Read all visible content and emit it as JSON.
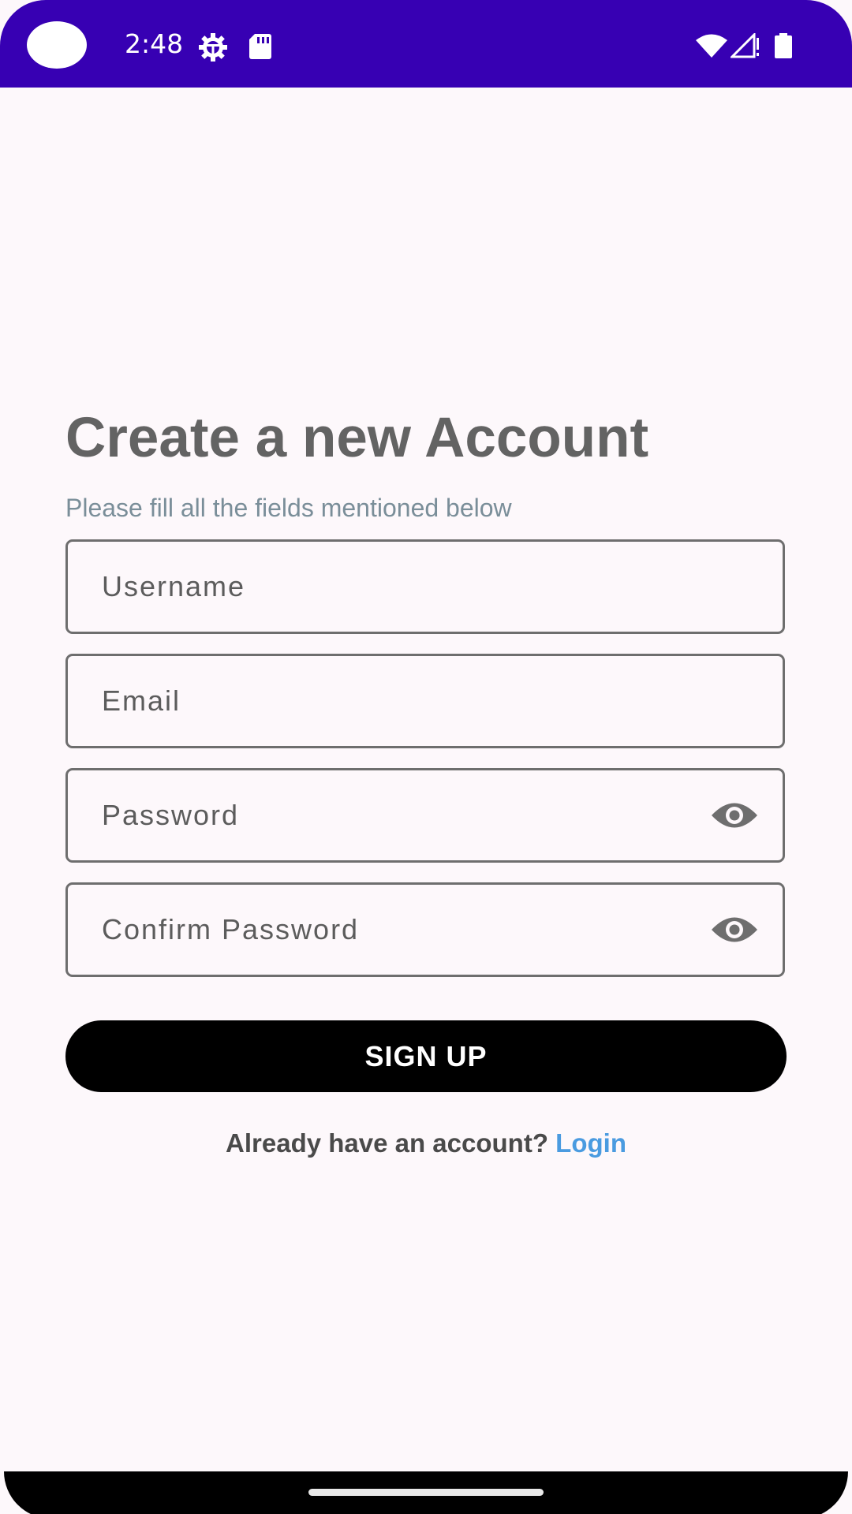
{
  "status_bar": {
    "time": "2:48",
    "background_color": "#3700B3",
    "left_icons": [
      "settings-gear-icon",
      "sd-card-icon"
    ],
    "right_icons": [
      "wifi-icon",
      "cell-signal-icon",
      "battery-icon"
    ]
  },
  "signup": {
    "title": "Create a new Account",
    "subtitle": "Please fill all the fields mentioned below",
    "fields": {
      "username": {
        "placeholder": "Username"
      },
      "email": {
        "placeholder": "Email"
      },
      "password": {
        "placeholder": "Password",
        "toggle_icon": "eye-icon"
      },
      "confirm_password": {
        "placeholder": "Confirm Password",
        "toggle_icon": "eye-icon"
      }
    },
    "signup_button_label": "SIGN UP",
    "login_prompt": "Already have an account?",
    "login_link": "Login"
  },
  "colors": {
    "accent_link": "#4A9BE0",
    "button_bg": "#000000",
    "page_bg": "#FDF8FB"
  }
}
